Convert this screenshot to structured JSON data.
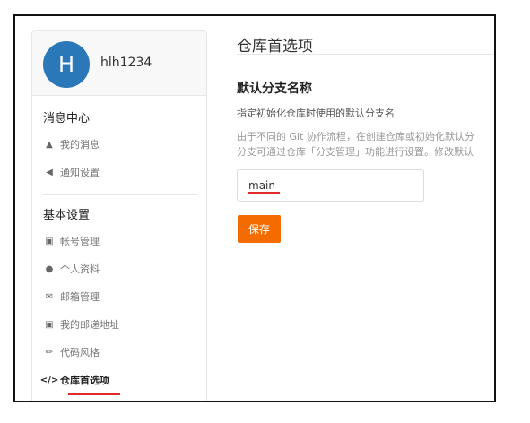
{
  "user": {
    "avatar_letter": "H",
    "name": "hlh1234"
  },
  "sidebar": {
    "groups": [
      {
        "title": "消息中心",
        "items": [
          {
            "label": "我的消息",
            "icon": "bell-icon"
          },
          {
            "label": "通知设置",
            "icon": "speaker-icon"
          }
        ]
      },
      {
        "title": "基本设置",
        "items": [
          {
            "label": "帐号管理",
            "icon": "id-card-icon"
          },
          {
            "label": "个人资料",
            "icon": "person-icon"
          },
          {
            "label": "邮箱管理",
            "icon": "envelope-icon"
          },
          {
            "label": "我的邮递地址",
            "icon": "address-card-icon"
          },
          {
            "label": "代码风格",
            "icon": "brush-icon"
          },
          {
            "label": "仓库首选项",
            "icon": "code-icon",
            "active": true
          }
        ]
      }
    ]
  },
  "main": {
    "title": "仓库首选项",
    "section_title": "默认分支名称",
    "description": "指定初始化仓库时使用的默认分支名",
    "help_line1": "由于不同的 Git 协作流程，在创建仓库或初始化默认分",
    "help_line2": "分支可通过仓库「分支管理」功能进行设置。修改默认",
    "branch_value": "main",
    "save_label": "保存"
  },
  "colors": {
    "accent": "#f46c00",
    "avatar": "#2b78b8",
    "underline": "#e02b2b"
  }
}
